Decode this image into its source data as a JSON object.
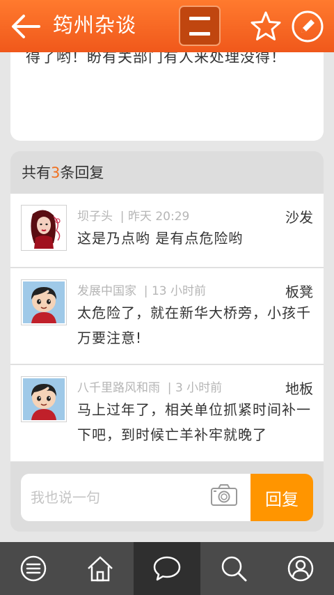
{
  "header": {
    "title": "筠州杂谈",
    "icons": [
      "back-arrow-icon",
      "menu-icon",
      "star-icon",
      "edit-icon"
    ]
  },
  "previous_post": {
    "text_tail": "得了哟！盼有关部门有人来处理没得！"
  },
  "replies": {
    "count_prefix": "共有",
    "count": "3",
    "count_suffix": "条回复",
    "items": [
      {
        "author": "坝子头",
        "time": "昨天 20:29",
        "floor": "沙发",
        "content": "这是乃点哟 是有点危险哟",
        "avatar": "woman-avatar"
      },
      {
        "author": "发展中国家",
        "time": "13 小时前",
        "floor": "板凳",
        "content": "太危险了，就在新华大桥旁，小孩千万要注意!",
        "avatar": "boy-avatar"
      },
      {
        "author": "八千里路风和雨",
        "time": "3 小时前",
        "floor": "地板",
        "content": "马上过年了，相关单位抓紧时间补一下吧，到时候亡羊补牢就晚了",
        "avatar": "boy-avatar"
      }
    ]
  },
  "reply_bar": {
    "placeholder": "我也说一句",
    "value": "",
    "send_label": "回复"
  },
  "bottom_nav": {
    "items": [
      {
        "icon": "list-icon",
        "active": false
      },
      {
        "icon": "home-icon",
        "active": false
      },
      {
        "icon": "chat-icon",
        "active": true
      },
      {
        "icon": "search-icon",
        "active": false
      },
      {
        "icon": "user-icon",
        "active": false
      }
    ]
  },
  "colors": {
    "header": "#f56320",
    "accent": "#ff9500",
    "count_highlight": "#f07020",
    "nav_bg": "#4a4a4a"
  }
}
